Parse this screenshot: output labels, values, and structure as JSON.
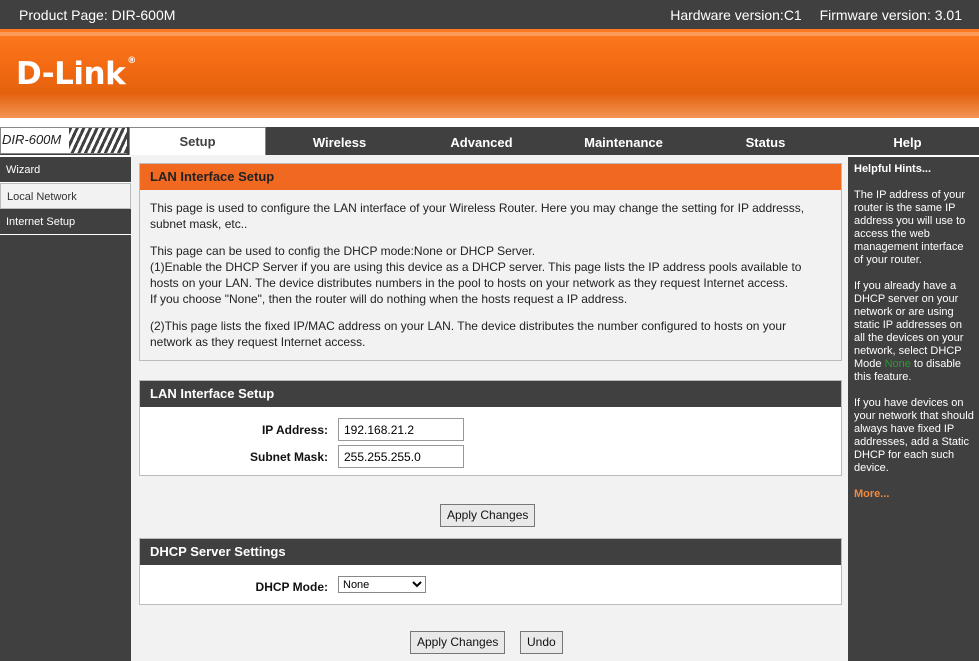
{
  "header": {
    "product": "Product Page: DIR-600M",
    "hardware": "Hardware version:C1",
    "firmware": "Firmware version: 3.01"
  },
  "logo": {
    "text": "D-Link",
    "mark": "®"
  },
  "model": "DIR-600M",
  "tabs": [
    {
      "label": "Setup",
      "active": true
    },
    {
      "label": "Wireless"
    },
    {
      "label": "Advanced"
    },
    {
      "label": "Maintenance"
    },
    {
      "label": "Status"
    },
    {
      "label": "Help"
    }
  ],
  "sidebar": {
    "items": [
      {
        "label": "Wizard"
      },
      {
        "label": "Local Network",
        "active": true
      },
      {
        "label": "Internet Setup"
      }
    ]
  },
  "intro": {
    "title": "LAN Interface Setup",
    "p1": "This page is used to configure the LAN interface of your Wireless Router. Here you may change the setting for IP addresss, subnet mask, etc..",
    "p2_line1": "This page can be used to config the DHCP mode:None or DHCP Server.",
    "p2_line2": "(1)Enable the DHCP Server if you are using this device as a DHCP server. This page lists the IP address pools available to hosts on your LAN. The device distributes numbers in the pool to hosts on your network as they request Internet access.",
    "p2_line3": "If you choose \"None\", then the router will do nothing when the hosts request a IP address.",
    "p3": "(2)This page lists the fixed IP/MAC address on your LAN. The device distributes the number configured to hosts on your network as they request Internet access."
  },
  "lan": {
    "title": "LAN Interface Setup",
    "ip_label": "IP Address:",
    "ip_value": "192.168.21.2",
    "mask_label": "Subnet Mask:",
    "mask_value": "255.255.255.0",
    "apply": "Apply Changes"
  },
  "dhcp": {
    "title": "DHCP Server Settings",
    "mode_label": "DHCP Mode:",
    "mode_value": "None",
    "apply": "Apply Changes",
    "undo": "Undo"
  },
  "hints": {
    "title": "Helpful Hints...",
    "p1": "The IP address of your router is the same IP address you will use to access the web management interface of your router.",
    "p2_before": "If you already have a DHCP server on your network or are using static IP addresses on all the devices on your network, select DHCP Mode ",
    "p2_highlight": "None",
    "p2_after": " to disable this feature.",
    "p3": "If you have devices on your network that should always have fixed IP addresses, add a Static DHCP for each such device.",
    "more": "More..."
  },
  "colors": {
    "accent": "#f16820",
    "dark": "#404040",
    "hint_green": "#2f9a2f"
  }
}
